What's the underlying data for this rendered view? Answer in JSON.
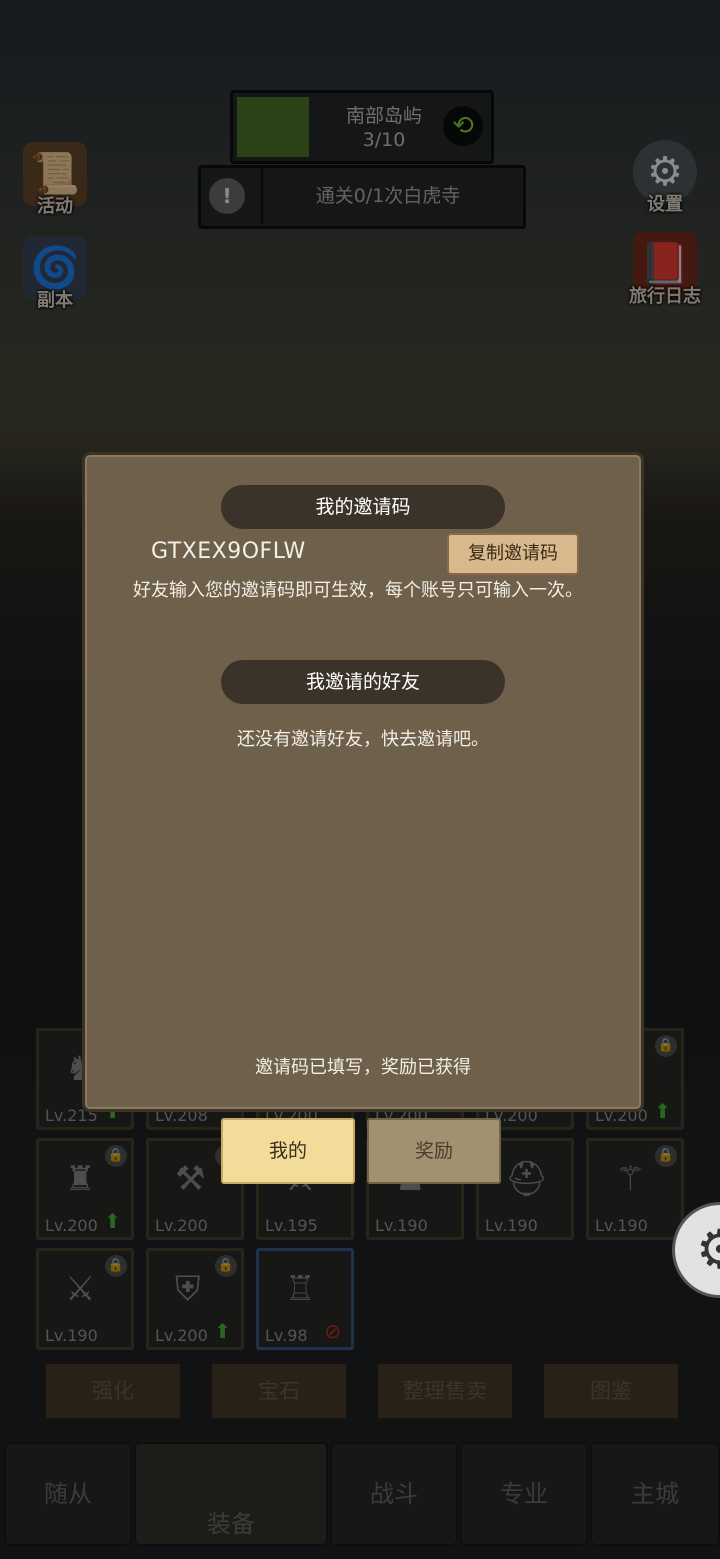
{
  "hud": {
    "stage_name": "南部岛屿",
    "stage_progress": "3/10",
    "quest_text": "通关0/1次白虎寺",
    "left_icons": [
      "活动",
      "副本"
    ],
    "right_icons": [
      "设置",
      "旅行日志"
    ]
  },
  "inventory": {
    "row1": [
      {
        "level": "Lv.215",
        "lock": false,
        "up": true
      },
      {
        "level": "Lv.208",
        "lock": false,
        "up": false
      },
      {
        "level": "Lv.200",
        "lock": false,
        "up": false
      },
      {
        "level": "Lv.200",
        "lock": false,
        "up": false
      },
      {
        "level": "Lv.200",
        "lock": false,
        "up": false
      },
      {
        "level": "Lv.200",
        "lock": true,
        "up": true
      }
    ],
    "row2": [
      {
        "level": "Lv.200",
        "lock": true,
        "up": true
      },
      {
        "level": "Lv.200",
        "lock": true,
        "up": false
      },
      {
        "level": "Lv.195",
        "lock": false,
        "up": false
      },
      {
        "level": "Lv.190",
        "lock": false,
        "up": false
      },
      {
        "level": "Lv.190",
        "lock": false,
        "up": false
      },
      {
        "level": "Lv.190",
        "lock": true,
        "up": false
      }
    ],
    "row3": [
      {
        "level": "Lv.190",
        "lock": true,
        "up": false
      },
      {
        "level": "Lv.200",
        "lock": true,
        "up": true
      },
      {
        "level": "Lv.98",
        "lock": false,
        "up": false
      }
    ],
    "actions": [
      "强化",
      "宝石",
      "整理售卖",
      "图鉴"
    ]
  },
  "bottom_nav": [
    "随从",
    "装备",
    "战斗",
    "专业",
    "主城"
  ],
  "modal": {
    "header_invite_code": "我的邀请码",
    "invite_code": "GTXEX9OFLW",
    "copy_button": "复制邀请码",
    "description": "好友输入您的邀请码即可生效，每个账号只可输入一次。",
    "header_friends": "我邀请的好友",
    "empty_friends": "还没有邀请好友，快去邀请吧。",
    "status": "邀请码已填写，奖励已获得"
  },
  "tabs": {
    "mine": "我的",
    "reward": "奖励"
  }
}
